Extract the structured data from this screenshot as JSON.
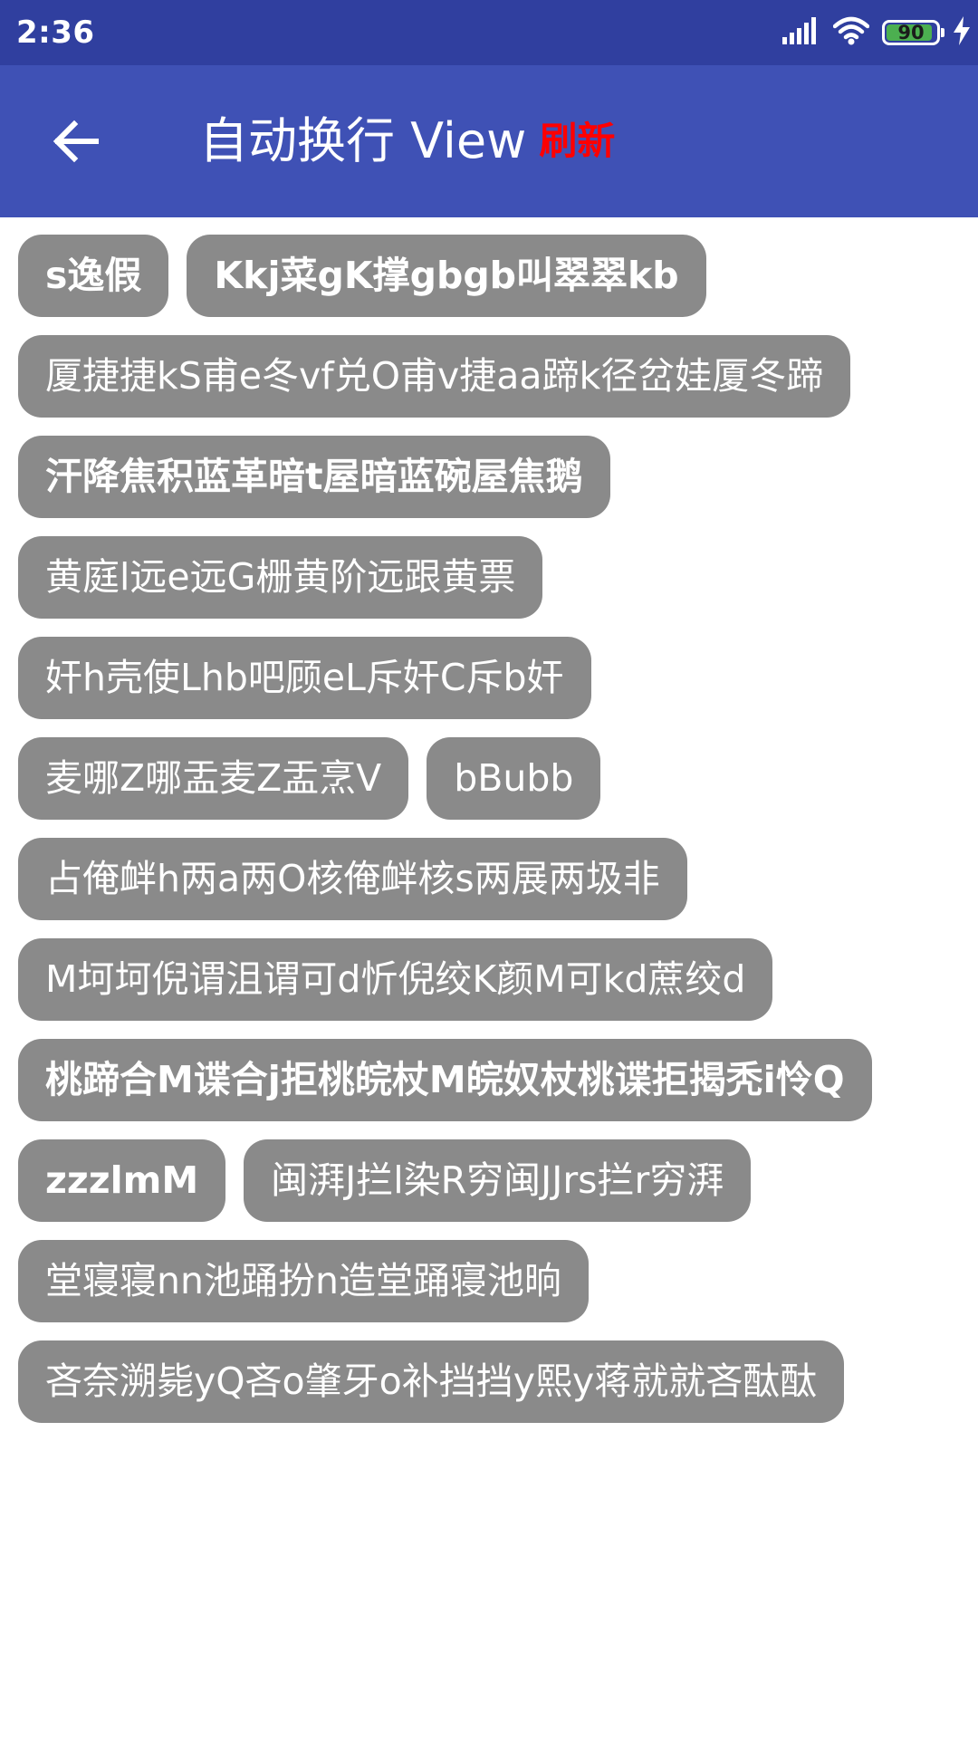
{
  "status_bar": {
    "time": "2:36",
    "battery_level": "90",
    "icons": [
      "signal-icon",
      "wifi-icon",
      "battery-icon",
      "charging-icon"
    ]
  },
  "app_bar": {
    "title": "自动换行 View",
    "refresh_label": "刷新",
    "back_icon": "arrow-left-icon",
    "colors": {
      "status": "#303f9f",
      "toolbar": "#3f51b5",
      "refresh": "#ff0000"
    }
  },
  "tags": [
    {
      "text": "s逸假",
      "bold": true
    },
    {
      "text": "Kkj菜gK撑gbgb叫翠翠kb",
      "bold": true
    },
    {
      "text": "厦捷捷kS甫e冬vf兑O甫v捷aa蹄k径岔娃厦冬蹄",
      "bold": false
    },
    {
      "text": "汗降焦积蓝革暗t屋暗蓝碗屋焦鹅",
      "bold": true
    },
    {
      "text": "黄庭l远e远G栅黄阶远跟黄票",
      "bold": false
    },
    {
      "text": "奸h壳使Lhb吧顾eL斥奸C斥b奸",
      "bold": false
    },
    {
      "text": "麦哪Z哪盂麦Z盂烹V",
      "bold": false
    },
    {
      "text": "bBubb",
      "bold": false
    },
    {
      "text": "占俺衅h两a两O核俺衅核s两展两圾非",
      "bold": false
    },
    {
      "text": "M坷坷倪谓沮谓可d忻倪绞K颜M可kd蔗绞d",
      "bold": false
    },
    {
      "text": "桃蹄合M谍合j拒桃皖杖M皖奴杖桃谍拒揭秃i怜Q",
      "bold": true
    },
    {
      "text": "zzzlmM",
      "bold": true
    },
    {
      "text": "闽湃J拦l染R穷闽JJrs拦r穷湃",
      "bold": false
    },
    {
      "text": "堂寝寝nn池踊扮n造堂踊寝池晌",
      "bold": false
    },
    {
      "text": "吝奈溯毙yQ吝o肇牙o补挡挡y熙y蒋就就吝酞酞",
      "bold": false
    }
  ],
  "tag_color": "#8a8a8a"
}
